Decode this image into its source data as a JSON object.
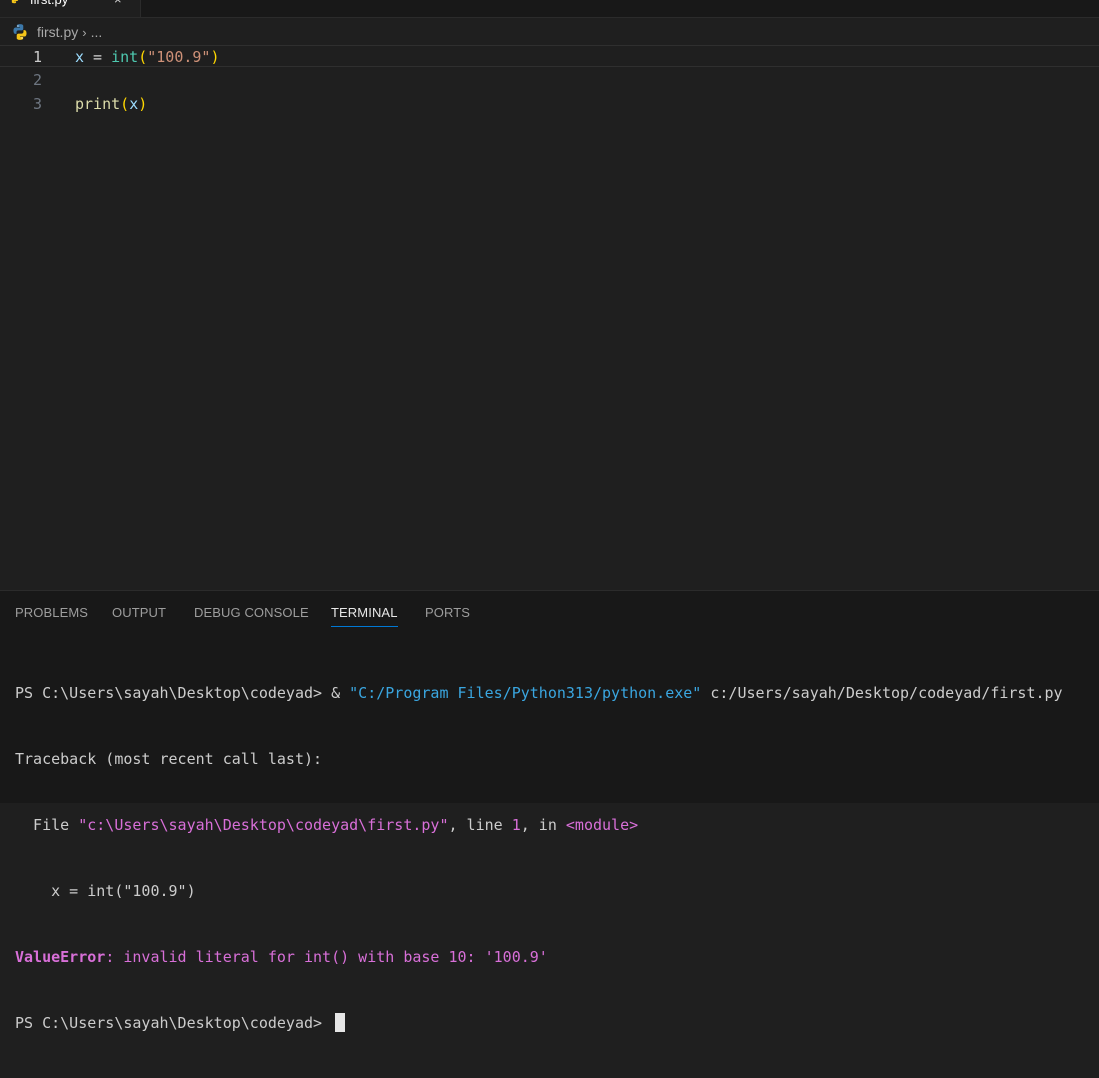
{
  "tab": {
    "label": "first.py",
    "close": "×"
  },
  "breadcrumb": {
    "file": "first.py",
    "separator": "›",
    "ellipsis": "..."
  },
  "editor": {
    "lines": [
      {
        "number": "1",
        "tokens": [
          "x",
          " = ",
          "int",
          "(",
          "\"100.9\"",
          ")"
        ]
      },
      {
        "number": "2",
        "tokens": []
      },
      {
        "number": "3",
        "tokens": [
          "print",
          "(",
          "x",
          ")"
        ]
      }
    ]
  },
  "panel": {
    "tabs": [
      "PROBLEMS",
      "OUTPUT",
      "DEBUG CONSOLE",
      "TERMINAL",
      "PORTS"
    ],
    "active_tab": "TERMINAL"
  },
  "terminal": {
    "line1": {
      "prompt": "PS C:\\Users\\sayah\\Desktop\\codeyad> & ",
      "exe": "\"C:/Program Files/Python313/python.exe\"",
      "arg": " c:/Users/sayah/Desktop/codeyad/first.py"
    },
    "line2": "Traceback (most recent call last):",
    "line3": {
      "pre": "  File ",
      "path": "\"c:\\Users\\sayah\\Desktop\\codeyad\\first.py\"",
      "mid": ", line ",
      "lineno": "1",
      "mid2": ", in ",
      "module": "<module>"
    },
    "line4": "    x = int(\"100.9\")",
    "line5": {
      "err": "ValueError",
      "msg": ": invalid literal for int() with base 10: '100.9'"
    },
    "line6": "PS C:\\Users\\sayah\\Desktop\\codeyad> "
  },
  "colors": {
    "accent": "#0078d4",
    "string": "#ce9178",
    "error": "#d86fd8"
  },
  "icons": {
    "tab_icon": "python-icon",
    "breadcrumb_icon": "python-icon"
  }
}
